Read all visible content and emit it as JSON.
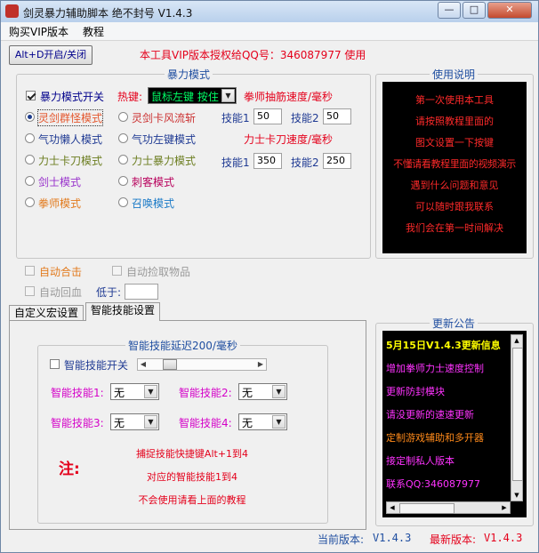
{
  "window": {
    "title": "剑灵暴力辅助脚本 绝不封号 V1.4.3"
  },
  "menu": {
    "buy_vip": "购买VIP版本",
    "tutorial": "教程"
  },
  "toolbar": {
    "toggle_button": "Alt+D开启/关闭",
    "vip_notice": "本工具VIP版本授权给QQ号：346087977 使用"
  },
  "violence": {
    "legend": "暴力模式",
    "switch_label": "暴力模式开关",
    "switch_checked": true,
    "hotkey_label": "热键:",
    "hotkey_value": "鼠标左键 按住",
    "quanshi_speed_label": "拳师抽筋速度/毫秒",
    "lishi_speed_label": "力士卡刀速度/毫秒",
    "modes": [
      {
        "label": "灵剑群怪模式",
        "selected": true,
        "color": "#e4572e"
      },
      {
        "label": "灵剑卡风流斩",
        "selected": false,
        "color": "#cc3333"
      },
      {
        "label": "气功懒人模式",
        "selected": false,
        "color": "#1f3a93"
      },
      {
        "label": "气功左键模式",
        "selected": false,
        "color": "#1f3a93"
      },
      {
        "label": "力士卡刀模式",
        "selected": false,
        "color": "#6b7d1f"
      },
      {
        "label": "力士暴力模式",
        "selected": false,
        "color": "#6b7d1f"
      },
      {
        "label": "剑士模式",
        "selected": false,
        "color": "#9933cc"
      },
      {
        "label": "刺客模式",
        "selected": false,
        "color": "#b8005c"
      },
      {
        "label": "拳师模式",
        "selected": false,
        "color": "#e27a1d"
      },
      {
        "label": "召唤模式",
        "selected": false,
        "color": "#1a7ac7"
      }
    ],
    "skill1_label": "技能1",
    "skill2_label": "技能2",
    "quanshi_skill1": "50",
    "quanshi_skill2": "50",
    "lishi_skill1": "350",
    "lishi_skill2": "250"
  },
  "usage": {
    "legend": "使用说明",
    "lines": [
      "第一次使用本工具",
      "请按照教程里面的",
      "图文设置一下按键",
      "不懂请看教程里面的视频演示",
      "遇到什么问题和意见",
      "可以随时跟我联系",
      "我们会在第一时间解决"
    ]
  },
  "options": {
    "auto_combine": "自动合击",
    "auto_pickup": "自动捡取物品",
    "auto_heal": "自动回血",
    "below_label": "低于:",
    "below_value": ""
  },
  "tabs": [
    {
      "label": "自定义宏设置",
      "active": false
    },
    {
      "label": "智能技能设置",
      "active": true
    }
  ],
  "smart": {
    "legend": "智能技能延迟200/毫秒",
    "switch_label": "智能技能开关",
    "switch_checked": false,
    "slider_value": 0.15,
    "skills": [
      {
        "label": "智能技能1:",
        "value": "无"
      },
      {
        "label": "智能技能2:",
        "value": "无"
      },
      {
        "label": "智能技能3:",
        "value": "无"
      },
      {
        "label": "智能技能4:",
        "value": "无"
      }
    ],
    "note_label": "注:",
    "note_lines": [
      "捕捉技能快捷键Alt+1到4",
      "对应的智能技能1到4",
      "不会使用请看上面的教程"
    ]
  },
  "announce": {
    "legend": "更新公告",
    "lines": [
      {
        "text": "5月15日V1.4.3更新信息",
        "color": "#ffff00"
      },
      {
        "text": "增加拳师力士速度控制",
        "color": "#ff33ff"
      },
      {
        "text": "更新防封模块",
        "color": "#ff33ff"
      },
      {
        "text": "请没更新的速速更新",
        "color": "#ff33ff"
      },
      {
        "text": "定制游戏辅助和多开器",
        "color": "#ff8a1a"
      },
      {
        "text": "接定制私人版本",
        "color": "#ff33ff"
      },
      {
        "text": "联系QQ:346087977",
        "color": "#ff33ff"
      }
    ]
  },
  "footer": {
    "current_label": "当前版本:",
    "current": "V1.4.3",
    "latest_label": "最新版本:",
    "latest": "V1.4.3"
  },
  "colors": {
    "vip": "#e4001b",
    "legend": "#1f4ea0",
    "speed": "#e4001b",
    "hint": "#ff2a2a",
    "skill": "#d400c8",
    "note": "#e4001b",
    "hotkey_fg": "#00ff66",
    "footer": "#1f4ea0"
  }
}
